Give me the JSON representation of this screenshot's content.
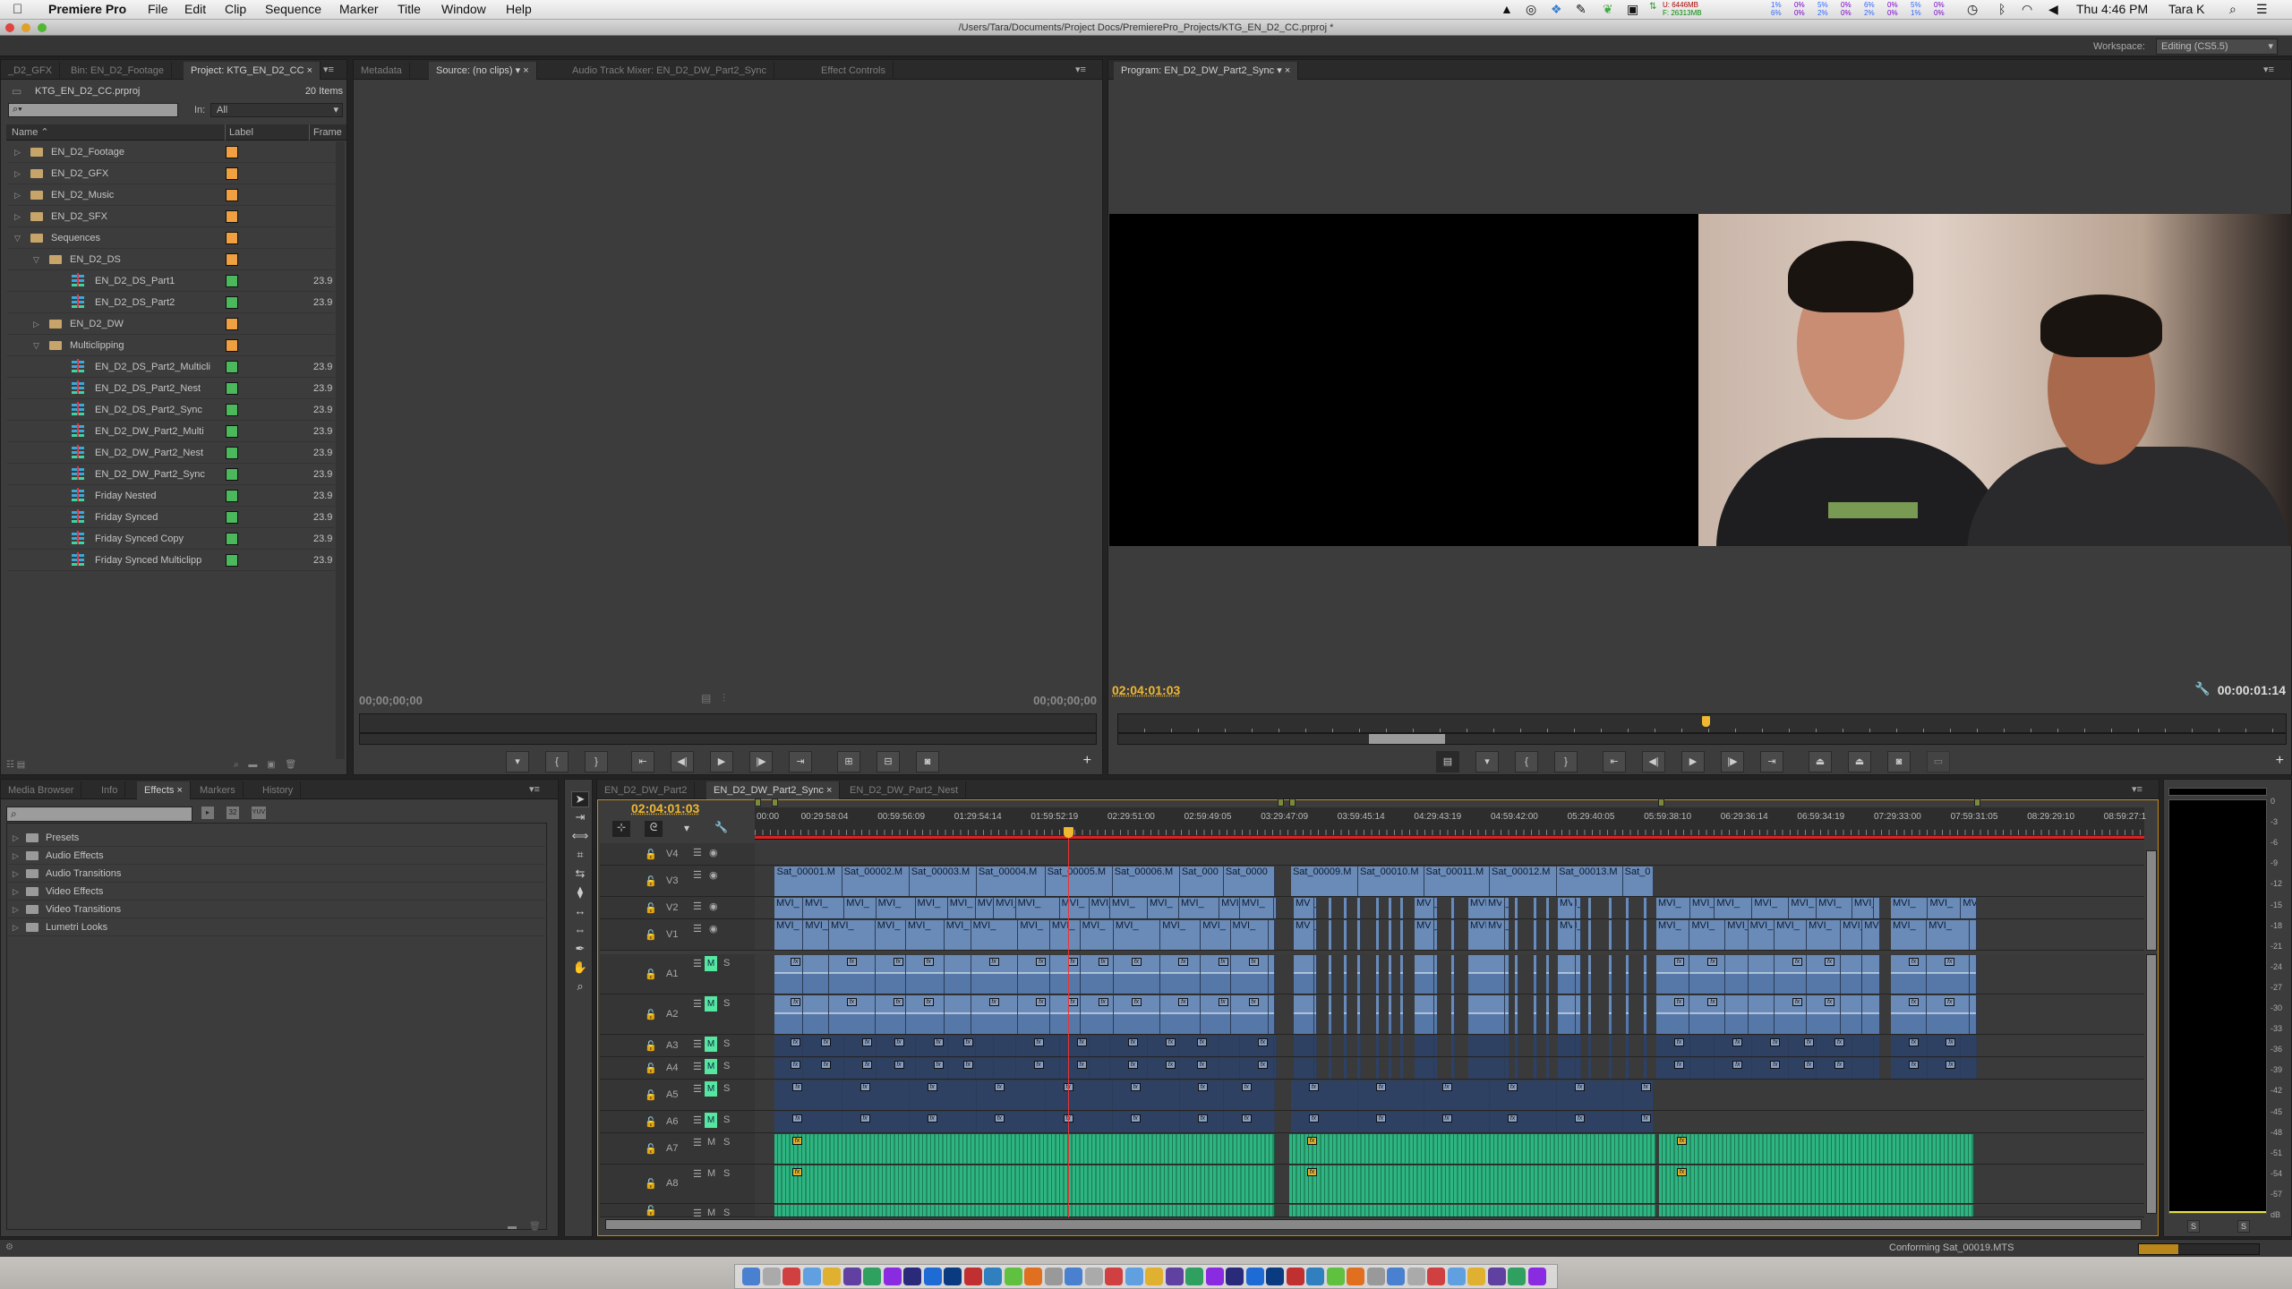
{
  "menubar": {
    "app": "Premiere Pro",
    "items": [
      "File",
      "Edit",
      "Clip",
      "Sequence",
      "Marker",
      "Title",
      "Window",
      "Help"
    ],
    "mem_used": "U: 6446MB",
    "mem_free": "F: 26313MB",
    "cpu_top": [
      "1%",
      "0%",
      "5%",
      "0%",
      "6%",
      "0%",
      "5%",
      "0%"
    ],
    "cpu_bottom": [
      "6%",
      "0%",
      "2%",
      "0%",
      "2%",
      "0%",
      "1%",
      "0%"
    ],
    "clock": "Thu 4:46 PM",
    "user": "Tara K",
    "icons": [
      "apple-icon",
      "drive-icon",
      "creative-cloud-icon",
      "dropbox-icon",
      "evernote-icon",
      "leaf-icon",
      "airplay-icon",
      "network-arrows-icon",
      "time-machine-icon",
      "bluetooth-icon",
      "wifi-icon",
      "volume-icon",
      "spotlight-search-icon",
      "notification-list-icon"
    ]
  },
  "window": {
    "path": "/Users/Tara/Documents/Project Docs/PremierePro_Projects/KTG_EN_D2_CC.prproj *"
  },
  "workspace": {
    "label": "Workspace:",
    "value": "Editing (CS5.5)"
  },
  "project": {
    "tabs": [
      "_D2_GFX",
      "Bin: EN_D2_Footage",
      "Project: KTG_EN_D2_CC"
    ],
    "file": "KTG_EN_D2_CC.prproj",
    "count": "20 Items",
    "in_label": "In:",
    "in_value": "All",
    "columns": {
      "name": "Name",
      "label": "Label",
      "frame": "Frame"
    },
    "items": [
      {
        "name": "EN_D2_Footage",
        "type": "folder",
        "level": 0,
        "open": false,
        "label": "#f0a040",
        "frame": ""
      },
      {
        "name": "EN_D2_GFX",
        "type": "folder",
        "level": 0,
        "open": false,
        "label": "#f0a040",
        "frame": ""
      },
      {
        "name": "EN_D2_Music",
        "type": "folder",
        "level": 0,
        "open": false,
        "label": "#f0a040",
        "frame": ""
      },
      {
        "name": "EN_D2_SFX",
        "type": "folder",
        "level": 0,
        "open": false,
        "label": "#f0a040",
        "frame": ""
      },
      {
        "name": "Sequences",
        "type": "folder",
        "level": 0,
        "open": true,
        "label": "#f0a040",
        "frame": ""
      },
      {
        "name": "EN_D2_DS",
        "type": "folder",
        "level": 1,
        "open": true,
        "label": "#f0a040",
        "frame": ""
      },
      {
        "name": "EN_D2_DS_Part1",
        "type": "sequence",
        "level": 2,
        "label": "#4cb85c",
        "frame": "23.9"
      },
      {
        "name": "EN_D2_DS_Part2",
        "type": "sequence",
        "level": 2,
        "label": "#4cb85c",
        "frame": "23.9"
      },
      {
        "name": "EN_D2_DW",
        "type": "folder",
        "level": 1,
        "open": false,
        "label": "#f0a040",
        "frame": ""
      },
      {
        "name": "Multiclipping",
        "type": "folder",
        "level": 1,
        "open": true,
        "label": "#f0a040",
        "frame": ""
      },
      {
        "name": "EN_D2_DS_Part2_Multicli",
        "type": "sequence",
        "level": 2,
        "label": "#4cb85c",
        "frame": "23.9"
      },
      {
        "name": "EN_D2_DS_Part2_Nest",
        "type": "sequence",
        "level": 2,
        "label": "#4cb85c",
        "frame": "23.9"
      },
      {
        "name": "EN_D2_DS_Part2_Sync",
        "type": "sequence",
        "level": 2,
        "label": "#4cb85c",
        "frame": "23.9"
      },
      {
        "name": "EN_D2_DW_Part2_Multi",
        "type": "sequence",
        "level": 2,
        "label": "#4cb85c",
        "frame": "23.9"
      },
      {
        "name": "EN_D2_DW_Part2_Nest",
        "type": "sequence",
        "level": 2,
        "label": "#4cb85c",
        "frame": "23.9"
      },
      {
        "name": "EN_D2_DW_Part2_Sync",
        "type": "sequence",
        "level": 2,
        "label": "#4cb85c",
        "frame": "23.9"
      },
      {
        "name": "Friday Nested",
        "type": "sequence",
        "level": 2,
        "label": "#4cb85c",
        "frame": "23.9"
      },
      {
        "name": "Friday Synced",
        "type": "sequence",
        "level": 2,
        "label": "#4cb85c",
        "frame": "23.9"
      },
      {
        "name": "Friday Synced Copy",
        "type": "sequence",
        "level": 2,
        "label": "#4cb85c",
        "frame": "23.9"
      },
      {
        "name": "Friday Synced Multiclipp",
        "type": "sequence",
        "level": 2,
        "label": "#4cb85c",
        "frame": "23.9"
      }
    ]
  },
  "source": {
    "tabs": [
      "Metadata",
      "Source: (no clips)",
      "Audio Track Mixer: EN_D2_DW_Part2_Sync",
      "Effect Controls"
    ],
    "tc_in": "00;00;00;00",
    "tc_out": "00;00;00;00"
  },
  "program": {
    "tab": "Program: EN_D2_DW_Part2_Sync",
    "timecode": "02:04:01:03",
    "duration": "00:00:01:14"
  },
  "effects": {
    "tabs": [
      "Media Browser",
      "Info",
      "Effects",
      "Markers",
      "History"
    ],
    "badges": [
      "32",
      "YUV"
    ],
    "items": [
      "Presets",
      "Audio Effects",
      "Audio Transitions",
      "Video Effects",
      "Video Transitions",
      "Lumetri Looks"
    ]
  },
  "timeline": {
    "tabs": [
      "EN_D2_DW_Part2",
      "EN_D2_DW_Part2_Sync",
      "EN_D2_DW_Part2_Nest"
    ],
    "timecode": "02:04:01:03",
    "ruler": [
      "00:00",
      "00:29:58:04",
      "00:59:56:09",
      "01:29:54:14",
      "01:59:52:19",
      "02:29:51:00",
      "02:59:49:05",
      "03:29:47:09",
      "03:59:45:14",
      "04:29:43:19",
      "04:59:42:00",
      "05:29:40:05",
      "05:59:38:10",
      "06:29:36:14",
      "06:59:34:19",
      "07:29:33:00",
      "07:59:31:05",
      "08:29:29:10",
      "08:59:27:1"
    ],
    "tracks": [
      "V4",
      "V3",
      "V2",
      "V1",
      "A1",
      "A2",
      "A3",
      "A4",
      "A5",
      "A6",
      "A7",
      "A8",
      ""
    ],
    "mute_label": "M",
    "solo_label": "S",
    "fx_label": "fx",
    "clip_prefix": "MVI_",
    "v3_clips": [
      "Sat_00001.M",
      "Sat_00002.M",
      "Sat_00003.M",
      "Sat_00004.M",
      "Sat_00005.M",
      "Sat_00006.M",
      "Sat_000",
      "Sat_0000",
      "Sat_00009.M",
      "Sat_00010.M",
      "Sat_00011.M",
      "Sat_00012.M",
      "Sat_00013.M",
      "Sat_0"
    ],
    "colors": {
      "video_clip": "#6a8bb7",
      "audio_clip": "#2e4163",
      "music_clip": "#2db582",
      "playhead": "#e8a820",
      "render_bar": "#e02020"
    }
  },
  "meters": {
    "scale": [
      "0",
      "-3",
      "-6",
      "-9",
      "-12",
      "-15",
      "-18",
      "-21",
      "-24",
      "-27",
      "-30",
      "-33",
      "-36",
      "-39",
      "-42",
      "-45",
      "-48",
      "-51",
      "-54",
      "-57",
      "dB"
    ],
    "solo": "S"
  },
  "status": {
    "text": "Conforming Sat_00019.MTS",
    "progress": 0.33
  }
}
